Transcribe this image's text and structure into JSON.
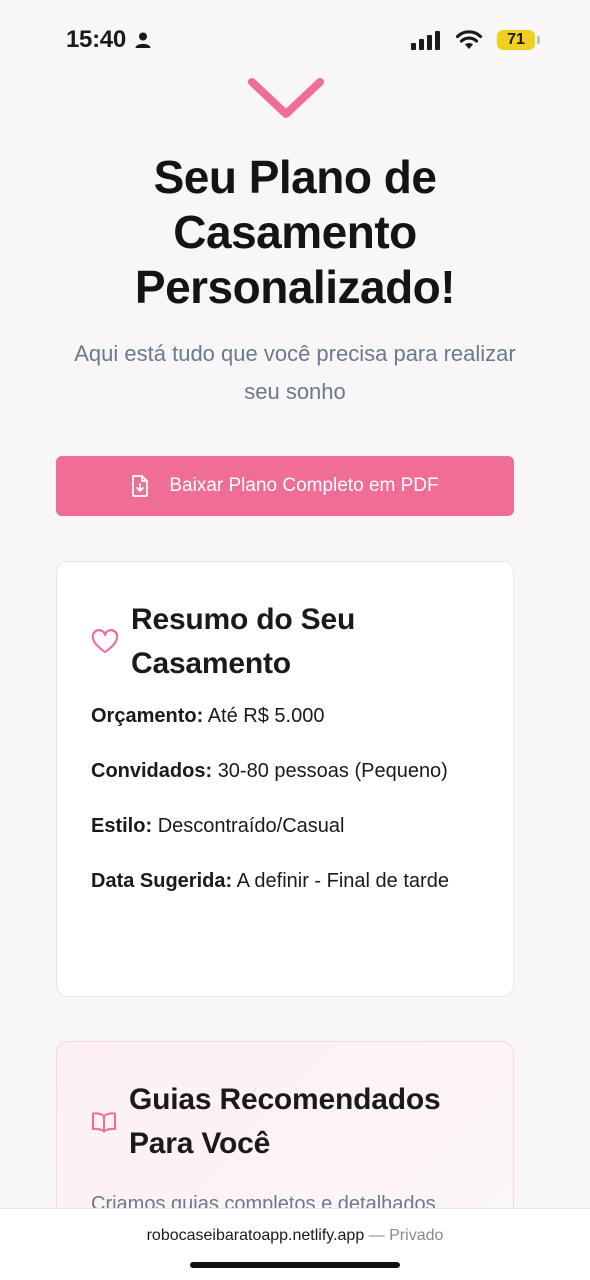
{
  "status_bar": {
    "time": "15:40",
    "battery": "71"
  },
  "header": {
    "title": "Seu Plano de Casamento Personalizado!",
    "subtitle": "Aqui está tudo que você precisa para realizar seu sonho"
  },
  "download_button": {
    "label": "Baixar Plano Completo em PDF",
    "icon": "file-download-icon"
  },
  "summary": {
    "icon": "heart-icon",
    "title": "Resumo do Seu Casamento",
    "items": [
      {
        "label": "Orçamento:",
        "value": "Até R$ 5.000"
      },
      {
        "label": "Convidados:",
        "value": "30-80 pessoas (Pequeno)"
      },
      {
        "label": "Estilo:",
        "value": "Descontraído/Casual"
      },
      {
        "label": "Data Sugerida:",
        "value": "A definir - Final de tarde"
      }
    ]
  },
  "guides": {
    "icon": "book-open-icon",
    "title": "Guias Recomendados Para Você",
    "description": "Criamos guias completos e detalhados"
  },
  "browser_bar": {
    "url": "robocaseibaratoapp.netlify.app",
    "mode": "— Privado"
  },
  "colors": {
    "accent": "#f06d96",
    "muted_text": "#6b7a8c"
  }
}
